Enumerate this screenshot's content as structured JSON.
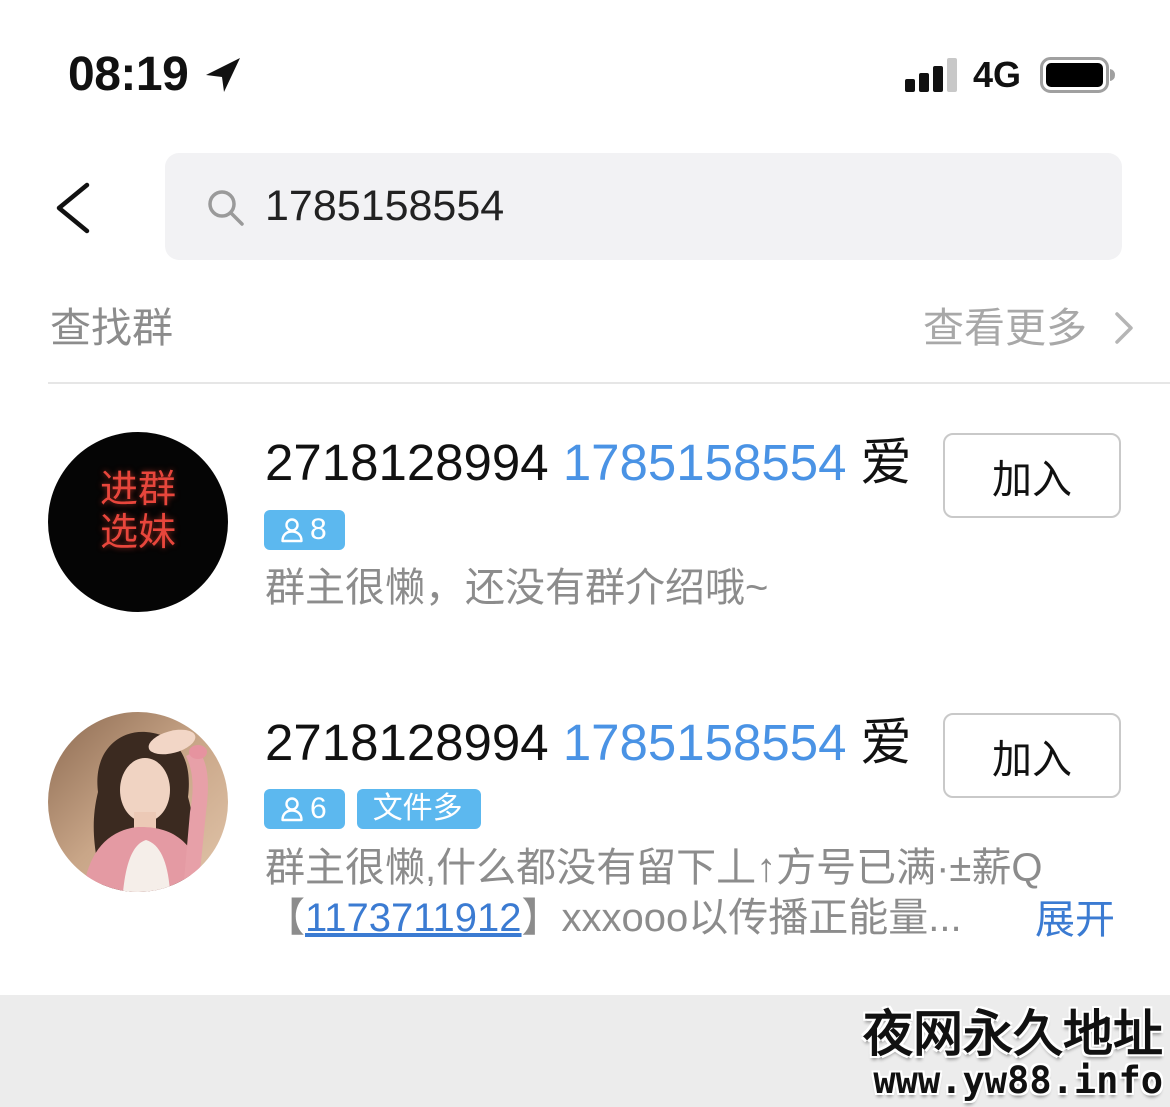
{
  "status_bar": {
    "time": "08:19",
    "network": "4G",
    "icons": [
      "location-arrow-icon",
      "signal-icon",
      "battery-icon"
    ]
  },
  "search": {
    "query": "1785158554",
    "icons": {
      "back": "chevron-left-icon",
      "search": "search-icon"
    }
  },
  "section": {
    "title": "查找群",
    "more_label": "查看更多",
    "more_icon": "chevron-right-icon"
  },
  "groups": [
    {
      "avatar_text": [
        "进群",
        "选妹"
      ],
      "name_prefix": "2718128994",
      "name_match": "1785158554",
      "name_suffix": "爱",
      "member_count": "8",
      "member_icon": "person-icon",
      "tags": [],
      "description": "群主很懒，还没有群介绍哦~",
      "join_label": "加入"
    },
    {
      "name_prefix": "2718128994",
      "name_match": "1785158554",
      "name_suffix": "爱",
      "member_count": "6",
      "member_icon": "person-icon",
      "tags": [
        "文件多"
      ],
      "description_line1": "群主很懒,什么都没有留下丄↑方号已满·±薪Q",
      "description_line2_open": "【",
      "description_link": "1173711912",
      "description_line2_rest": "】xxxooo以传播正能量...",
      "expand_label": "展开",
      "join_label": "加入"
    }
  ],
  "watermark": {
    "line1": "夜网永久地址",
    "line2": "www.yw88.info"
  },
  "colors": {
    "accent": "#4a93e5",
    "badge": "#5cb8ef",
    "link": "#3b7bd2",
    "secondary_text": "#8c8c8c",
    "avatar_text": "#e8463c"
  }
}
